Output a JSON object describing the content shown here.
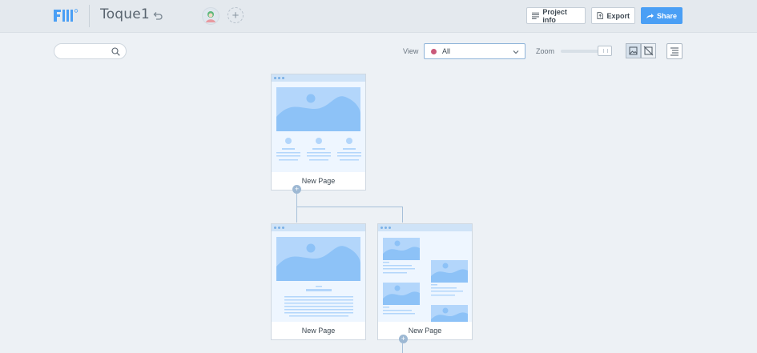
{
  "app": {
    "project_title": "Toque1"
  },
  "header": {
    "project_info_label": "Project info",
    "export_label": "Export",
    "share_label": "Share"
  },
  "toolbar": {
    "view_label": "View",
    "view_value": "All",
    "zoom_label": "Zoom",
    "search_placeholder": ""
  },
  "pages": [
    {
      "label": "New Page",
      "layout": "home"
    },
    {
      "label": "New Page",
      "layout": "article"
    },
    {
      "label": "New Page",
      "layout": "gallery"
    }
  ],
  "colors": {
    "accent": "#4a9ff5",
    "view_dot": "#c9597a",
    "wireframe_fill": "#b3d6fb"
  },
  "icons": [
    "logo-icon",
    "undo-icon",
    "avatar",
    "plus-icon",
    "list-icon",
    "export-icon",
    "share-arrow-icon",
    "search-icon",
    "chevron-down-icon",
    "image-view-icon",
    "no-image-view-icon",
    "outline-icon"
  ]
}
